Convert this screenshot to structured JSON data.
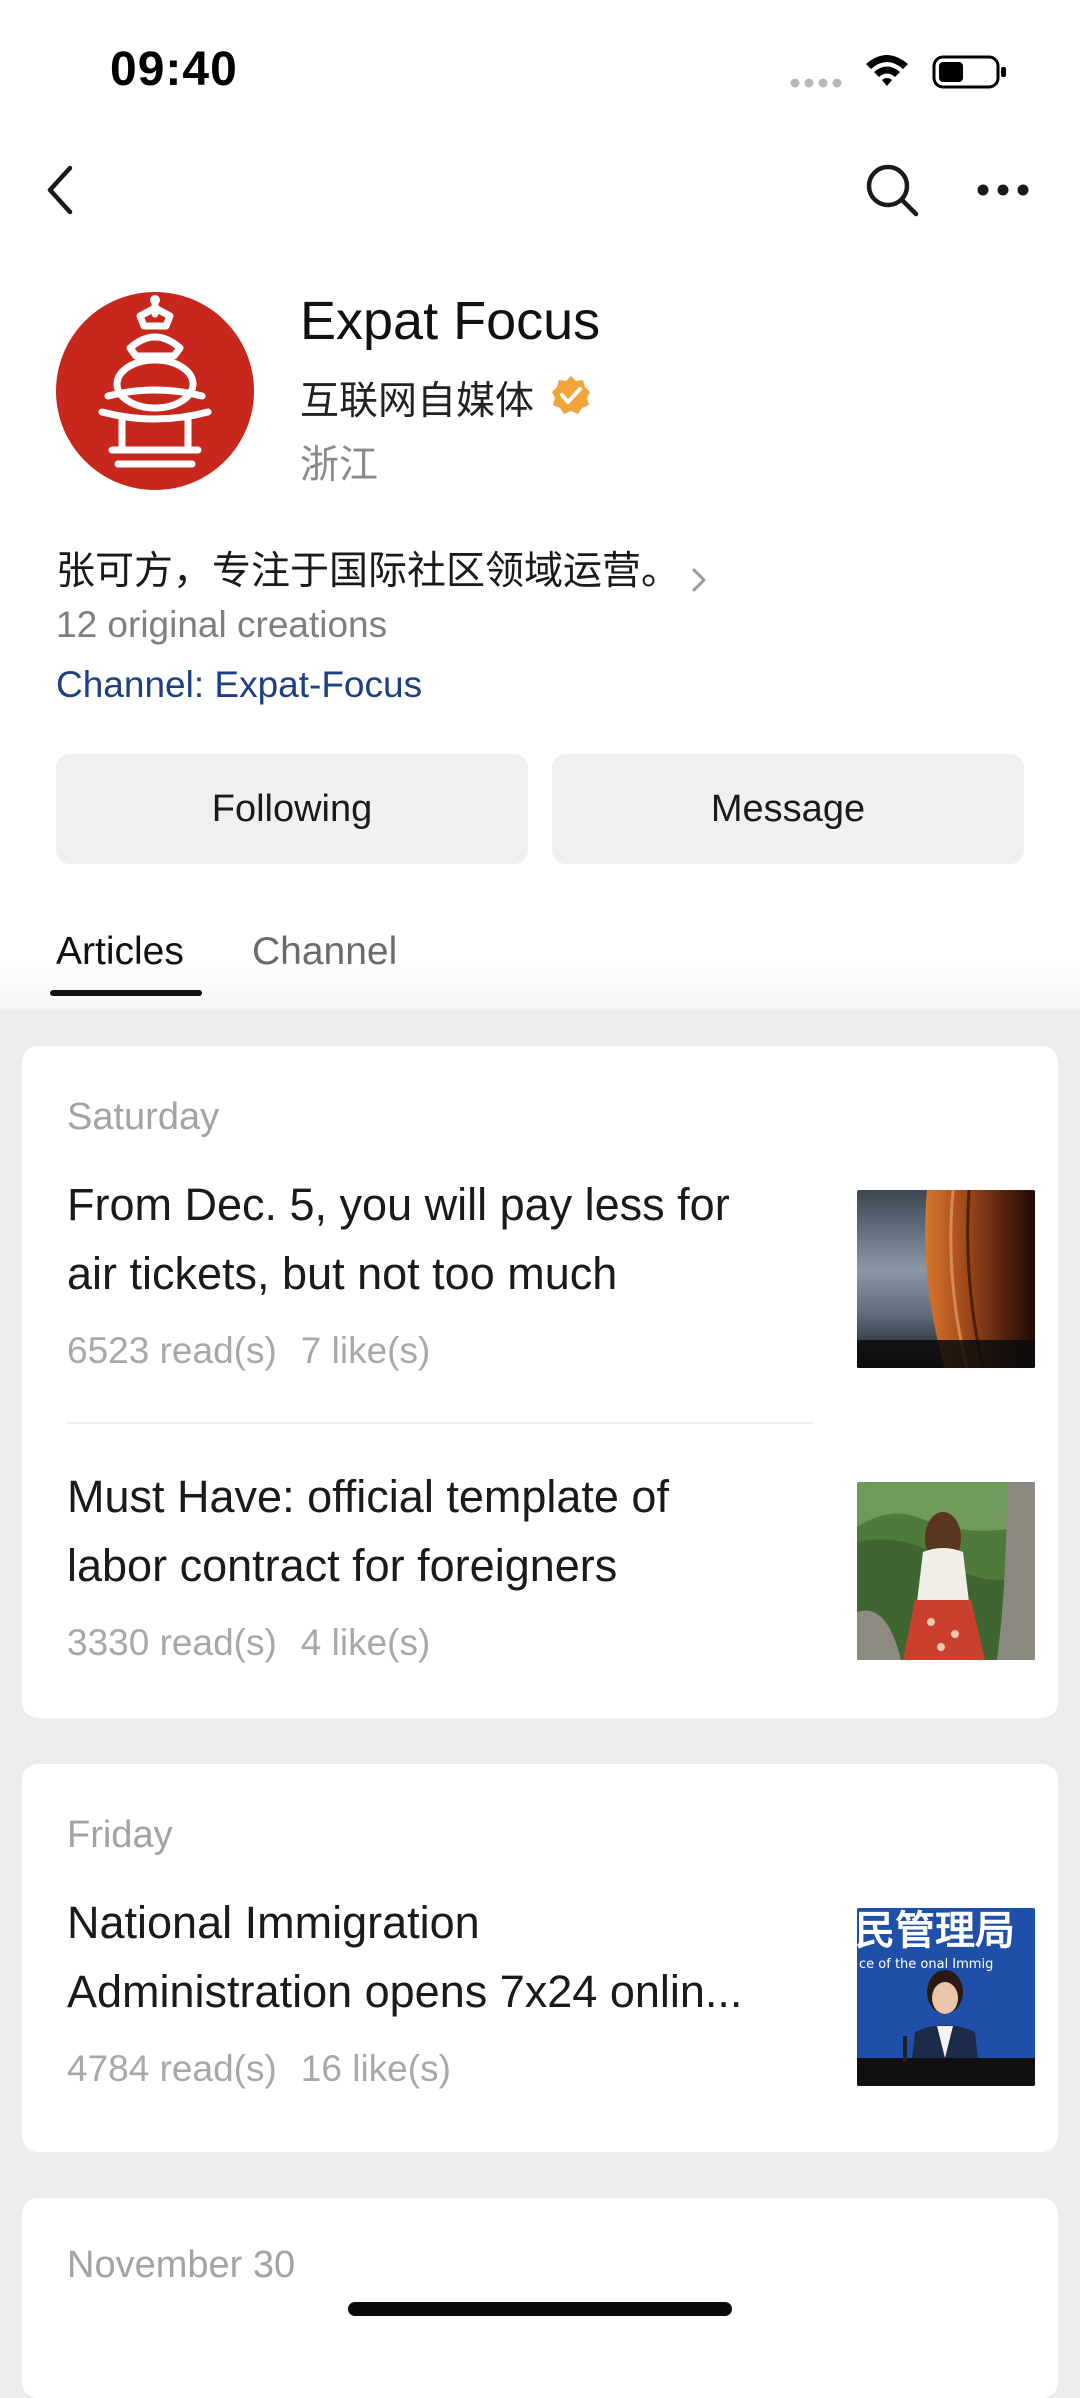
{
  "status_bar": {
    "time": "09:40"
  },
  "profile": {
    "name": "Expat Focus",
    "type": "互联网自媒体",
    "region": "浙江",
    "bio": "张可方，专注于国际社区领域运营。",
    "creations": "12 original creations",
    "channel": "Channel: Expat-Focus",
    "avatar_color": "#c8271e",
    "verified_color": "#f0a43a"
  },
  "actions": {
    "following_label": "Following",
    "message_label": "Message"
  },
  "tabs": [
    {
      "label": "Articles",
      "active": true
    },
    {
      "label": "Channel",
      "active": false
    }
  ],
  "groups": [
    {
      "day": "Saturday",
      "articles": [
        {
          "title_line1": "From Dec. 5, you will pay less for",
          "title_line2": "air tickets, but not too much",
          "reads": "6523 read(s)",
          "likes": "7 like(s)",
          "thumb": "airplane-window-image"
        },
        {
          "title_line1": "Must Have: official template of",
          "title_line2": "labor contract for foreigners",
          "reads": "3330 read(s)",
          "likes": "4 like(s)",
          "thumb": "great-wall-image"
        }
      ]
    },
    {
      "day": "Friday",
      "articles": [
        {
          "title_line1": "National Immigration",
          "title_line2": "Administration opens 7x24 onlin...",
          "reads": "4784 read(s)",
          "likes": "16 like(s)",
          "thumb": "press-conference-image",
          "thumb_sign_text": "民管理局",
          "thumb_sign_subtext": "ce of the  onal Immig"
        }
      ]
    },
    {
      "day": "November 30"
    }
  ]
}
